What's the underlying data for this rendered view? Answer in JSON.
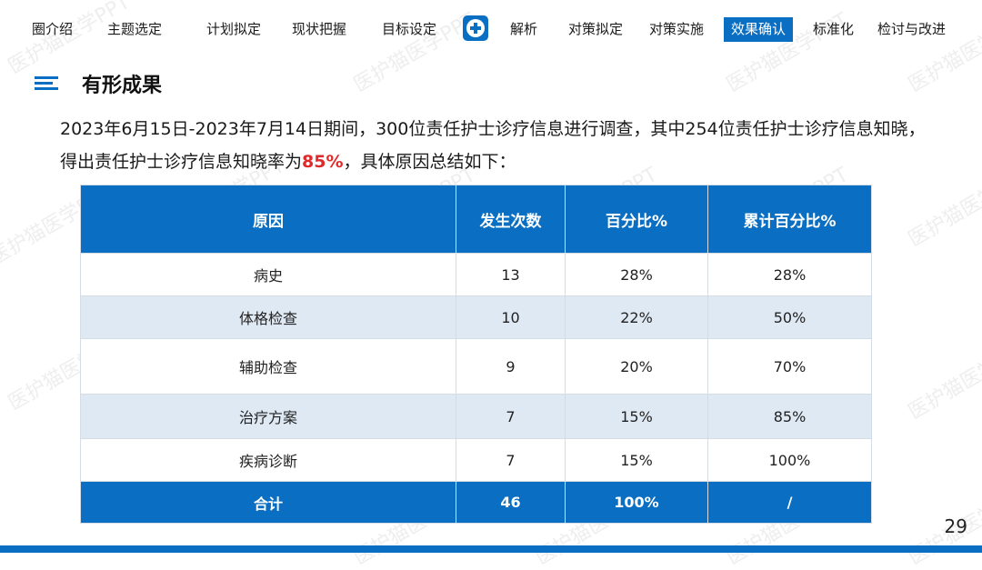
{
  "nav": {
    "items": [
      "圈介绍",
      "主题选定",
      "计划拟定",
      "现状把握",
      "目标设定",
      "解析",
      "对策拟定",
      "对策实施",
      "效果确认",
      "标准化",
      "检讨与改进"
    ],
    "active": "效果确认"
  },
  "section": {
    "title": "有形成果"
  },
  "description": {
    "line1": "2023年6月15日-2023年7月14日期间，300位责任护士诊疗信息进行调查，其中254位责任护士诊疗信息知晓，",
    "line2_prefix": "得出责任护士诊疗信息知晓率为",
    "line2_highlight": "85%",
    "line2_suffix": "，具体原因总结如下："
  },
  "table": {
    "headers": [
      "原因",
      "发生次数",
      "百分比%",
      "累计百分比%"
    ],
    "rows": [
      [
        "病史",
        "13",
        "28%",
        "28%"
      ],
      [
        "体格检查",
        "10",
        "22%",
        "50%"
      ],
      [
        "辅助检查",
        "9",
        "20%",
        "70%"
      ],
      [
        "治疗方案",
        "7",
        "15%",
        "85%"
      ],
      [
        "疾病诊断",
        "7",
        "15%",
        "100%"
      ]
    ],
    "total": [
      "合计",
      "46",
      "100%",
      "/"
    ]
  },
  "watermark": "医护猫医学PPT",
  "page_number": "29",
  "colors": {
    "accent": "#0a6fc2",
    "highlight": "#e02a2a",
    "stripe": "#dfe9f4"
  }
}
